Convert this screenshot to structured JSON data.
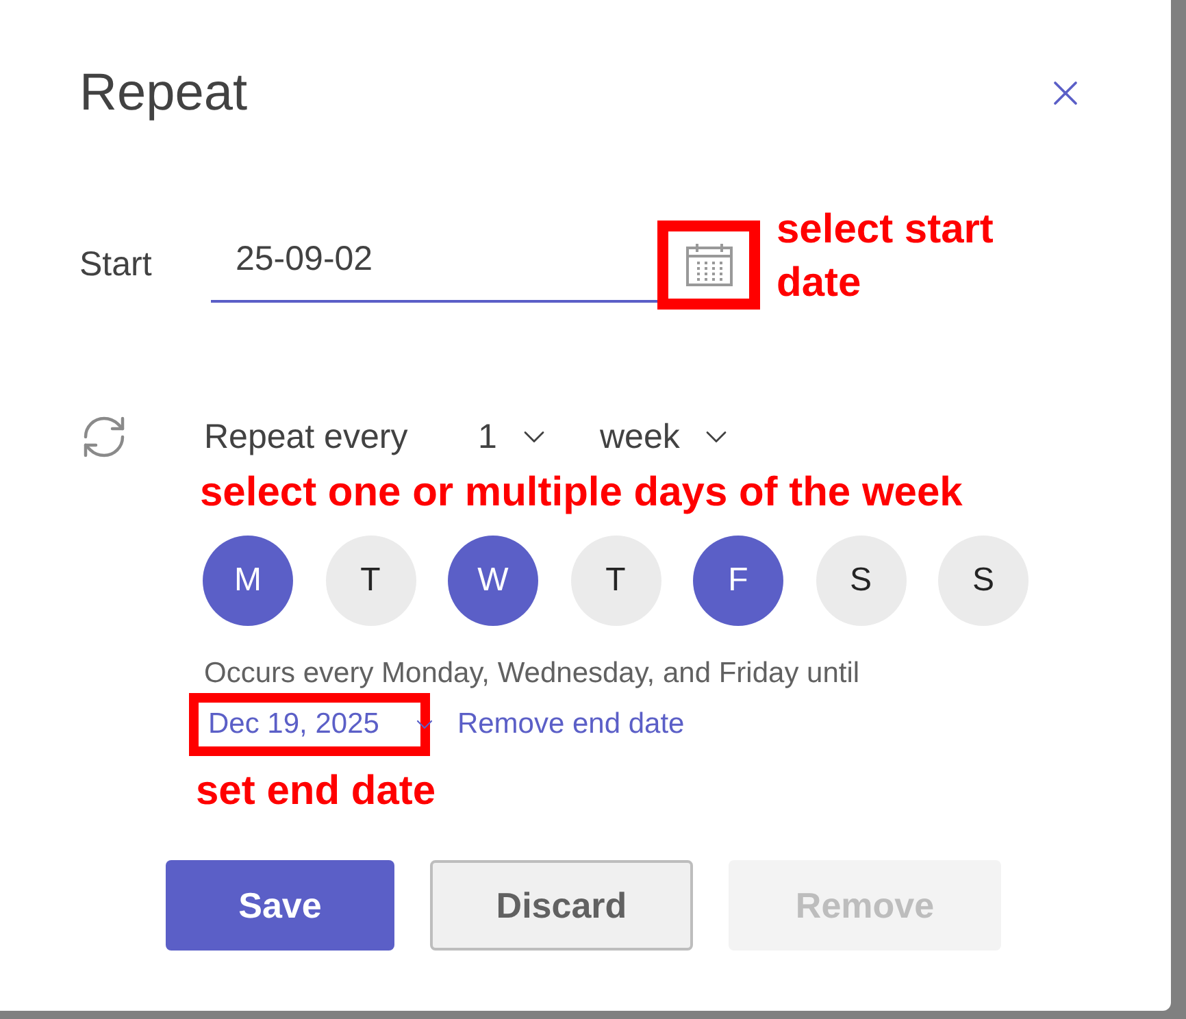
{
  "dialog": {
    "title": "Repeat"
  },
  "start": {
    "label": "Start",
    "value": "25-09-02",
    "calendar_highlighted": true
  },
  "repeat": {
    "label": "Repeat every",
    "interval": "1",
    "unit": "week"
  },
  "days": [
    {
      "label": "M",
      "selected": true
    },
    {
      "label": "T",
      "selected": false
    },
    {
      "label": "W",
      "selected": true
    },
    {
      "label": "T",
      "selected": false
    },
    {
      "label": "F",
      "selected": true
    },
    {
      "label": "S",
      "selected": false
    },
    {
      "label": "S",
      "selected": false
    }
  ],
  "summary": "Occurs every Monday, Wednesday, and Friday until",
  "end": {
    "date": "Dec 19, 2025",
    "highlighted": true,
    "remove": "Remove end date"
  },
  "buttons": [
    {
      "label": "Save",
      "kind": "primary",
      "disabled": false
    },
    {
      "label": "Discard",
      "kind": "secondary",
      "disabled": false
    },
    {
      "label": "Remove",
      "kind": "secondary",
      "disabled": true
    }
  ],
  "annotations": [
    {
      "text": "select start date"
    },
    {
      "text": "select one or multiple days of the week"
    },
    {
      "text": "set end date"
    }
  ]
}
